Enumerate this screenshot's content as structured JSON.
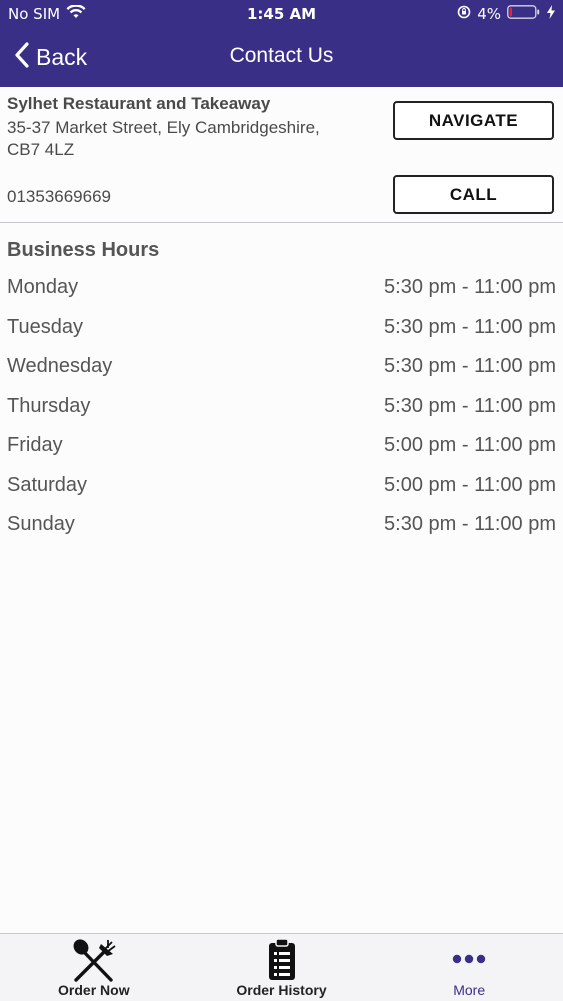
{
  "status_bar": {
    "carrier": "No SIM",
    "time": "1:45 AM",
    "battery": "4%"
  },
  "nav": {
    "back_label": "Back",
    "title": "Contact Us"
  },
  "contact": {
    "name": "Sylhet Restaurant and Takeaway",
    "address_line1": "35-37 Market Street, Ely Cambridgeshire,",
    "address_line2": "CB7 4LZ",
    "phone": "01353669669",
    "navigate_label": "NAVIGATE",
    "call_label": "CALL"
  },
  "hours": {
    "title": "Business Hours",
    "days": [
      {
        "day": "Monday",
        "time": "5:30 pm - 11:00 pm"
      },
      {
        "day": "Tuesday",
        "time": "5:30 pm - 11:00 pm"
      },
      {
        "day": "Wednesday",
        "time": "5:30 pm - 11:00 pm"
      },
      {
        "day": "Thursday",
        "time": "5:30 pm - 11:00 pm"
      },
      {
        "day": "Friday",
        "time": "5:00 pm - 11:00 pm"
      },
      {
        "day": "Saturday",
        "time": "5:00 pm - 11:00 pm"
      },
      {
        "day": "Sunday",
        "time": "5:30 pm - 11:00 pm"
      }
    ]
  },
  "tabs": [
    {
      "label": "Order Now",
      "icon": "fork-spoon-icon"
    },
    {
      "label": "Order History",
      "icon": "clipboard-list-icon"
    },
    {
      "label": "More",
      "icon": "more-dots-icon"
    }
  ],
  "colors": {
    "header": "#3a2f86",
    "accent": "#3a2f86",
    "battery_low": "#e2263a"
  }
}
